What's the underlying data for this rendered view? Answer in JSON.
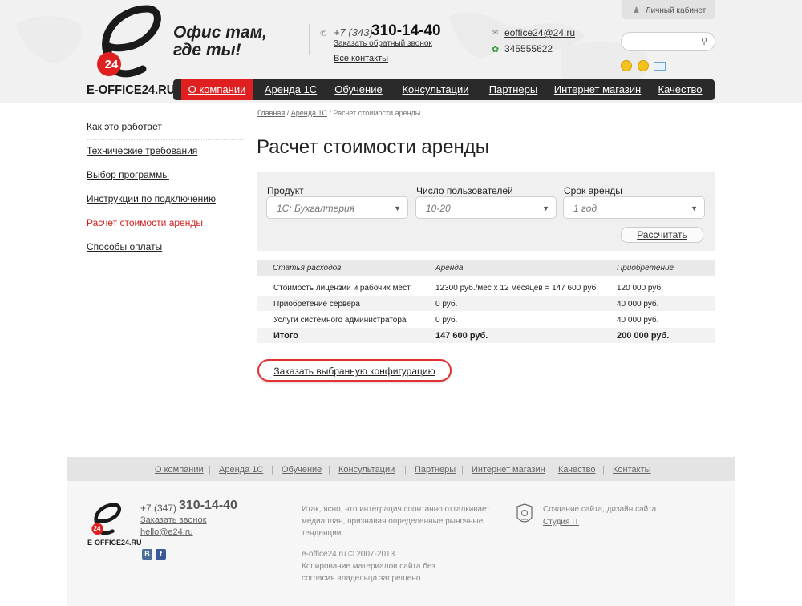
{
  "header": {
    "logo_text": "E-OFFICE24.RU",
    "logo_badge": "24",
    "slogan_line1": "Офис там,",
    "slogan_line2": "где ты!",
    "phone_prefix": "+7 (343)",
    "phone_number": "310-14-40",
    "callback_label": "Заказать обратный звонок",
    "all_contacts_label": "Все контакты",
    "email": "eoffice24@24.ru",
    "icq": "345555622",
    "cabinet_label": "Личный кабинет",
    "search_placeholder": ""
  },
  "nav": {
    "items": [
      {
        "label": "О компании",
        "active": true
      },
      {
        "label": "Аренда 1С",
        "active": false
      },
      {
        "label": "Обучение",
        "active": false
      },
      {
        "label": "Консультации",
        "active": false
      },
      {
        "label": "Партнеры",
        "active": false
      },
      {
        "label": "Интернет магазин",
        "active": false
      },
      {
        "label": "Качество",
        "active": false
      }
    ]
  },
  "sidebar": {
    "items": [
      {
        "label": "Как это работает"
      },
      {
        "label": "Технические требования"
      },
      {
        "label": "Выбор программы"
      },
      {
        "label": "Инструкции по подключению"
      },
      {
        "label": "Расчет стоимости аренды",
        "active": true
      },
      {
        "label": "Способы оплаты"
      }
    ]
  },
  "breadcrumb": {
    "home": "Главная",
    "section": "Аренда 1С",
    "current": "Расчет стоимости аренды",
    "sep": " / "
  },
  "main": {
    "title": "Расчет стоимости аренды",
    "form": {
      "product_label": "Продукт",
      "product_value": "1С: Бухгалтерия",
      "users_label": "Число пользователей",
      "users_value": "10-20",
      "term_label": "Срок аренды",
      "term_value": "1 год",
      "calc_button": "Рассчитать"
    },
    "table": {
      "headers": [
        "Статья расходов",
        "Аренда",
        "Приобретение"
      ],
      "rows": [
        [
          "Стоимость лицензии и рабочих мест",
          "12300 руб./мес х 12 месяцев = 147 600 руб.",
          "120 000 руб."
        ],
        [
          "Приобретение сервера",
          "0 руб.",
          "40 000 руб."
        ],
        [
          "Услуги системного администратора",
          "0 руб.",
          "40 000 руб."
        ]
      ],
      "total": [
        "Итого",
        "147 600 руб.",
        "200 000 руб."
      ]
    },
    "order_button": "Заказать выбранную конфигурацию"
  },
  "footer": {
    "nav": [
      "О компании",
      "Аренда 1С",
      "Обучение",
      "Консультации",
      "Партнеры",
      "Интернет магазин",
      "Качество",
      "Контакты"
    ],
    "logo_text": "E-OFFICE24.RU",
    "logo_badge": "24",
    "phone_prefix": "+7 (347)",
    "phone_number": "310-14-40",
    "callback_label": "Заказать звонок",
    "email": "hello@e24.ru",
    "social": [
      "В",
      "f"
    ],
    "about_text_1": "Итак, ясно, что интеграция спонтанно отталкивает",
    "about_text_2": "медиаплан, признавая определенные рыночные",
    "about_text_3": "тенденции.",
    "copyright_1": "e-office24.ru © 2007-2013",
    "copyright_2": "Копирование материалов сайта без",
    "copyright_3": "согласия владельца запрещено.",
    "studio_text": "Создание сайта, дизайн сайта",
    "studio_link": "Студия IT"
  },
  "colors": {
    "accent_red": "#e02020",
    "nav_dark": "#2a2a2a",
    "header_bg": "#f1f1f1"
  }
}
